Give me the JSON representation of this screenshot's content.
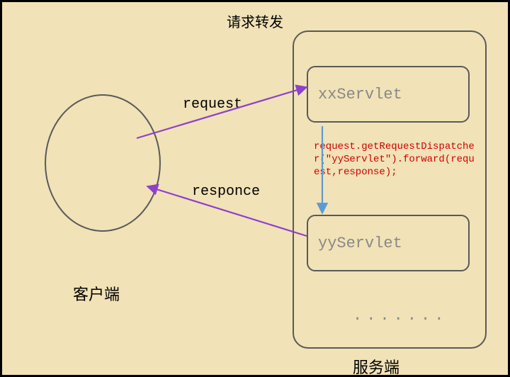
{
  "title": "请求转发",
  "client": {
    "label": "客户端"
  },
  "server": {
    "label": "服务端",
    "xx": "xxServlet",
    "yy": "yyServlet",
    "dots": ".......",
    "code": "request.getRequestDispatcher(\"yyServlet\").forward(request,response);"
  },
  "arrows": {
    "request_label": "request",
    "response_label": "responce"
  },
  "chart_data": {
    "type": "diagram",
    "title": "请求转发",
    "nodes": [
      {
        "id": "client",
        "label": "客户端",
        "shape": "ellipse"
      },
      {
        "id": "server",
        "label": "服务端",
        "shape": "rounded-rect",
        "children": [
          {
            "id": "xxServlet",
            "label": "xxServlet"
          },
          {
            "id": "yyServlet",
            "label": "yyServlet"
          }
        ]
      }
    ],
    "edges": [
      {
        "from": "client",
        "to": "xxServlet",
        "label": "request",
        "color": "purple"
      },
      {
        "from": "xxServlet",
        "to": "yyServlet",
        "label": "request.getRequestDispatcher(\"yyServlet\").forward(request,response);",
        "color": "blue"
      },
      {
        "from": "yyServlet",
        "to": "client",
        "label": "responce",
        "color": "purple"
      }
    ]
  }
}
